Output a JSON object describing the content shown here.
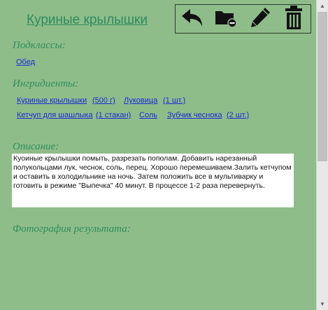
{
  "title": "Куриные крылышки",
  "toolbar": {
    "icons": [
      "undo-icon",
      "folder-remove-icon",
      "pencil-icon",
      "trash-icon"
    ]
  },
  "subclasses": {
    "label": "Подклассы:",
    "items": [
      "Обед"
    ]
  },
  "ingredients": {
    "label": "Ингридиенты:",
    "items": [
      {
        "name": "Куриные крылышки",
        "qty": "(500 г)"
      },
      {
        "name": "Луковица",
        "qty": "(1 шт.)"
      },
      {
        "name": "Кетчуп для шашлыка",
        "qty": "(1 стакан)"
      },
      {
        "name": "Соль",
        "qty": ""
      },
      {
        "name": "Зубчик чеснока",
        "qty": "(2 шт.)"
      }
    ]
  },
  "description": {
    "label": "Описание:",
    "text": "Куоиные крылышки помыть, разрезать пополам. Добавить нарезанный полукольцами лук, чеснок, соль, перец. Хорошо перемешиваем.Залить кетчупом и оставить в холодильнике на ночь. Затем положить все в мультиварку и готовить в режиме \"Выпечка\" 40 минут. В процессе 1-2 раза перевернуть."
  },
  "photo": {
    "label": "Фотография результата:"
  },
  "colors": {
    "background": "#8fbd8a",
    "heading": "#2b8b5e",
    "link": "#1a2bd8"
  }
}
